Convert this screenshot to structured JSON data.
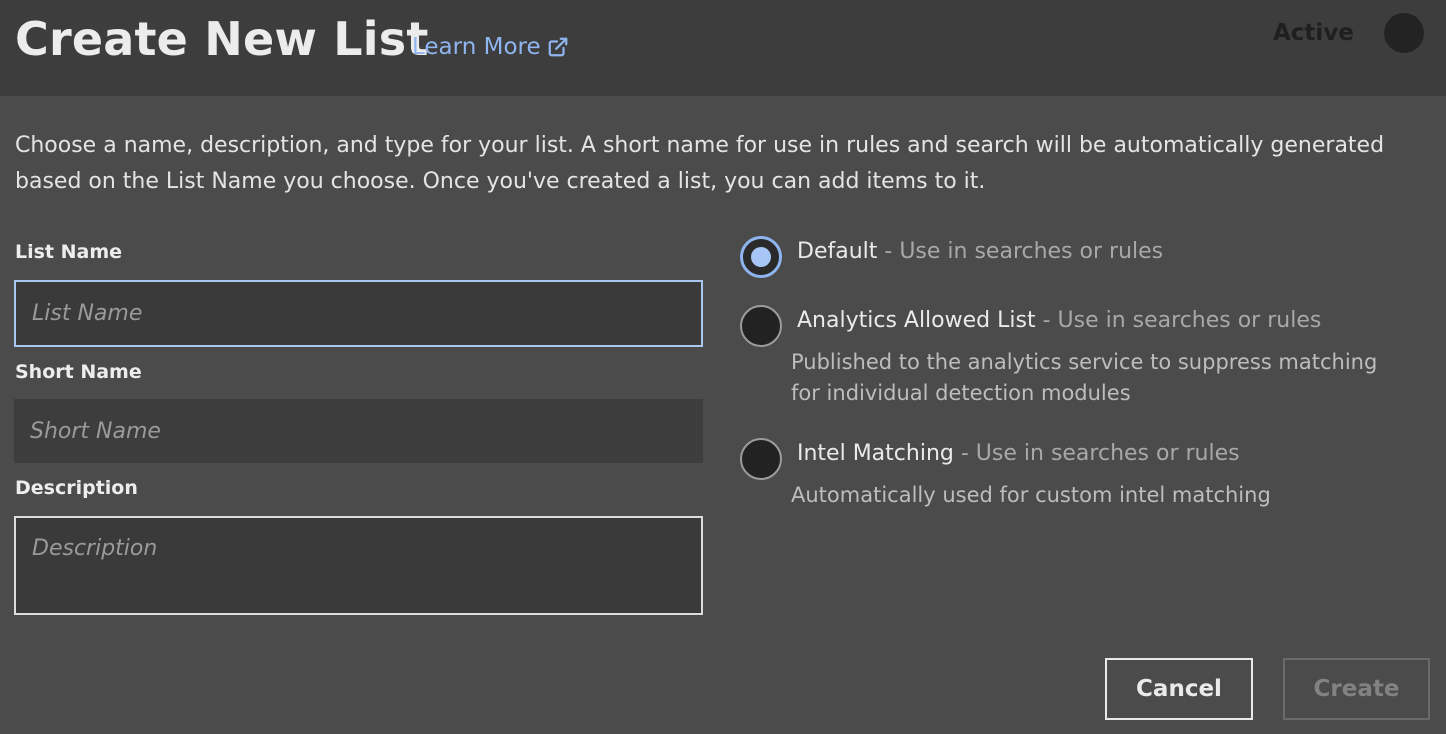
{
  "header": {
    "title": "Create New List",
    "learn_more": "Learn More",
    "active_label": "Active"
  },
  "intro": "Choose a name, description, and type for your list. A short name for use in rules and search will be automatically generated based on the List Name you choose. Once you've created a list, you can add items to it.",
  "form": {
    "list_name": {
      "label": "List Name",
      "placeholder": "List Name",
      "value": ""
    },
    "short_name": {
      "label": "Short Name",
      "placeholder": "Short Name",
      "value": ""
    },
    "description": {
      "label": "Description",
      "placeholder": "Description",
      "value": ""
    }
  },
  "list_types": [
    {
      "name": "Default",
      "separator": " - ",
      "subtitle": "Use in searches or rules",
      "description": "",
      "selected": true
    },
    {
      "name": "Analytics Allowed List",
      "separator": " - ",
      "subtitle": "Use in searches or rules",
      "description": "Published to the analytics service to suppress matching for individual detection modules",
      "selected": false
    },
    {
      "name": "Intel Matching",
      "separator": " - ",
      "subtitle": "Use in searches or rules",
      "description": "Automatically used for custom intel matching",
      "selected": false
    }
  ],
  "buttons": {
    "cancel": "Cancel",
    "create": "Create"
  },
  "colors": {
    "accent": "#8fb5f0",
    "background": "#4b4b4b",
    "header": "#3d3d3d"
  },
  "icons": {
    "learn_more": "external-link-icon"
  }
}
